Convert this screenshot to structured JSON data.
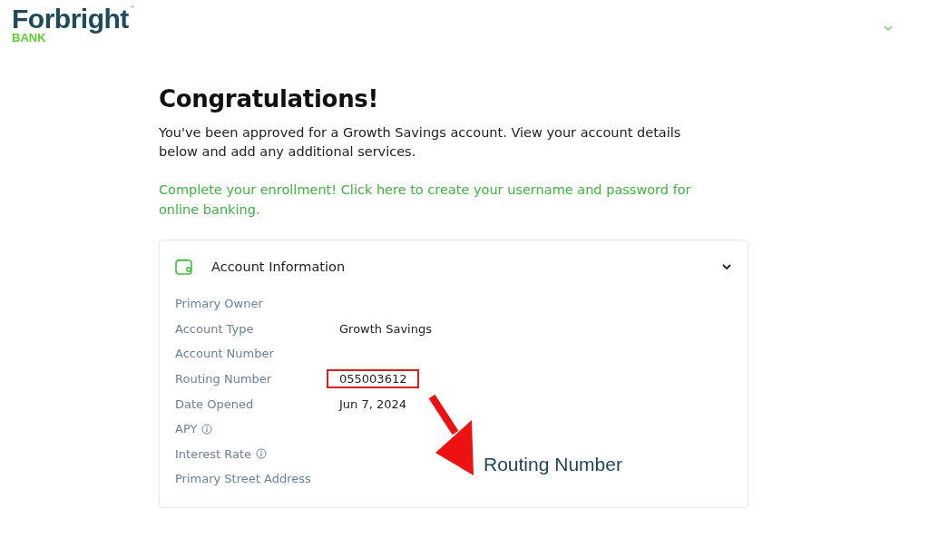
{
  "header": {
    "logo": {
      "name": "Forbright",
      "tagline": "BANK",
      "trademark": "™"
    }
  },
  "title": "Congratulations!",
  "intro": "You've been approved for a Growth Savings account. View your account details below and add any additional services.",
  "enrollment_link": "Complete your enrollment! Click here to create your username and password for online banking.",
  "card": {
    "title": "Account Information",
    "expanded": true,
    "rows": [
      {
        "label": "Primary Owner"
      },
      {
        "label": "Account Type",
        "value": "Growth Savings"
      },
      {
        "label": "Account Number"
      },
      {
        "label": "Routing Number",
        "value": "055003612",
        "highlighted": true
      },
      {
        "label": "Date Opened",
        "value": "Jun 7, 2024"
      },
      {
        "label": "APY",
        "info": true
      },
      {
        "label": "Interest Rate",
        "info": true
      },
      {
        "label": "Primary Street Address"
      }
    ]
  },
  "annotation": {
    "label": "Routing Number"
  }
}
